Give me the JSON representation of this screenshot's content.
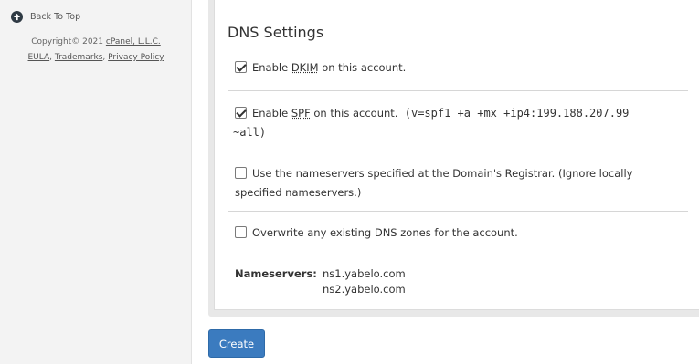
{
  "sidebar": {
    "back_to_top": "Back To Top",
    "copyright_prefix": "Copyright© 2021 ",
    "copyright_company": "cPanel, L.L.C.",
    "links": [
      "EULA",
      "Trademarks",
      "Privacy Policy"
    ]
  },
  "panel": {
    "title": "DNS Settings",
    "dkim": {
      "checked": true,
      "pre": "Enable ",
      "abbr": "DKIM",
      "post": " on this account."
    },
    "spf": {
      "checked": true,
      "pre": "Enable ",
      "abbr": "SPF",
      "post": " on this account.",
      "record_line1": "(v=spf1 +a +mx +ip4:199.188.207.99",
      "record_line2": "~all)"
    },
    "registrar_ns": {
      "checked": false,
      "line1": "Use the nameservers specified at the Domain's Registrar. (Ignore locally",
      "line2": "specified nameservers.)"
    },
    "overwrite": {
      "checked": false,
      "label": "Overwrite any existing DNS zones for the account."
    },
    "nameservers_label": "Nameservers:",
    "nameservers": [
      "ns1.yabelo.com",
      "ns2.yabelo.com"
    ]
  },
  "actions": {
    "create_label": "Create"
  },
  "colors": {
    "primary_button": "#3b7bbf",
    "sidebar_bg": "#f3f3f3"
  }
}
